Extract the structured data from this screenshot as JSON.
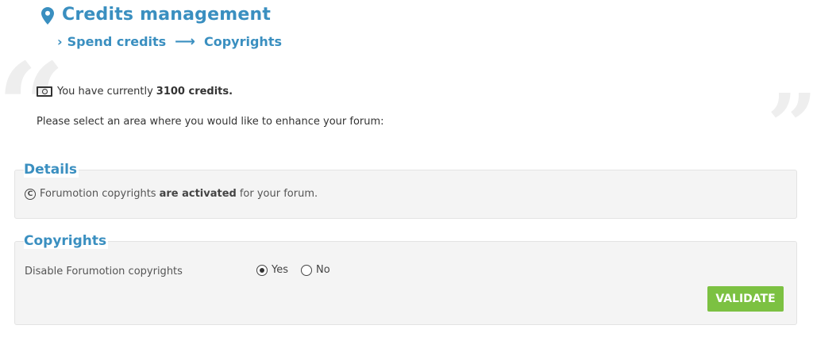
{
  "header": {
    "title": "Credits management",
    "breadcrumb": {
      "chevron": "›",
      "item1": "Spend credits",
      "arrow": "⟶",
      "item2": "Copyrights"
    }
  },
  "credits": {
    "prefix": "You have currently",
    "amount": "3100 credits."
  },
  "instruction": "Please select an area where you would like to enhance your forum:",
  "details": {
    "legend": "Details",
    "text_before": "Forumotion copyrights",
    "text_bold": "are activated",
    "text_after": "for your forum."
  },
  "copyrights": {
    "legend": "Copyrights",
    "option_label": "Disable Forumotion copyrights",
    "yes_label": "Yes",
    "no_label": "No",
    "selected": "Yes",
    "validate_label": "VALIDATE"
  },
  "colors": {
    "accent": "#3a8fc0",
    "button": "#7cc142"
  },
  "icons": [
    "map-pin-icon",
    "money-icon",
    "copyright-icon",
    "quote-left-icon",
    "quote-right-icon"
  ]
}
